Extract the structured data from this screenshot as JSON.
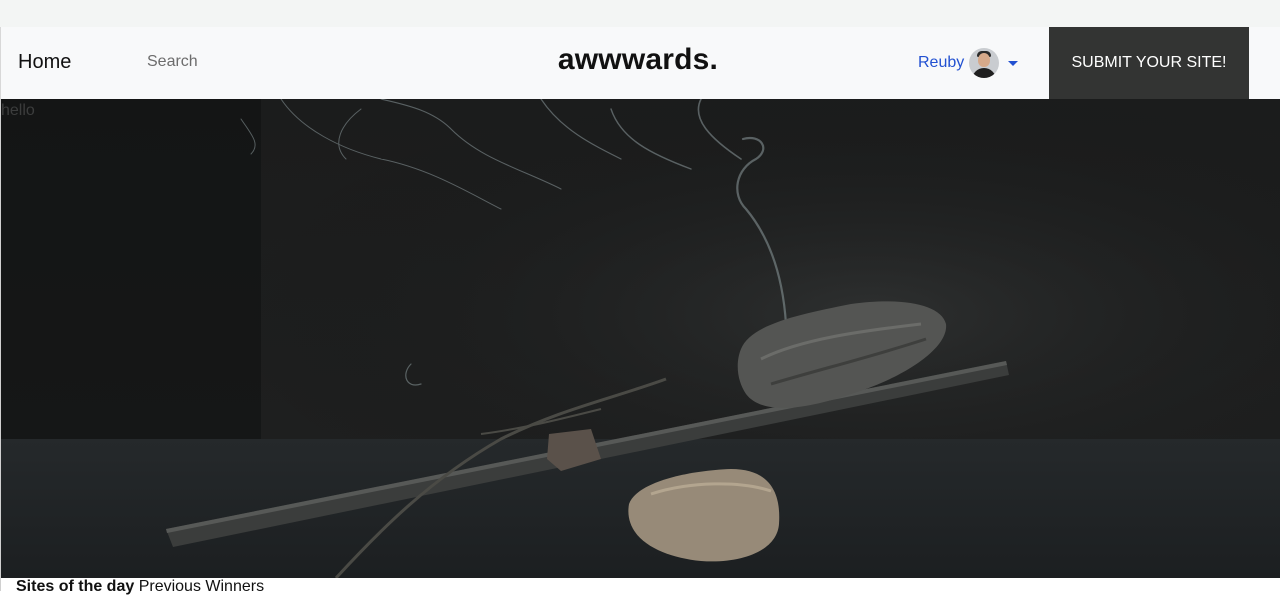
{
  "navbar": {
    "home_label": "Home",
    "search_placeholder": "Search",
    "brand": "awwwards.",
    "user_name": "Reuby",
    "submit_label": "SUBMIT YOUR SITE!"
  },
  "hero": {
    "text": "hello"
  },
  "sections": {
    "sites_of_the_day": "Sites of the day",
    "previous_winners": "Previous Winners"
  },
  "colors": {
    "user_link": "#2251d1",
    "submit_bg": "#333433",
    "navbar_bg": "#f8f9fa"
  },
  "icons": {
    "caret": "caret-down-icon",
    "avatar": "user-avatar"
  }
}
